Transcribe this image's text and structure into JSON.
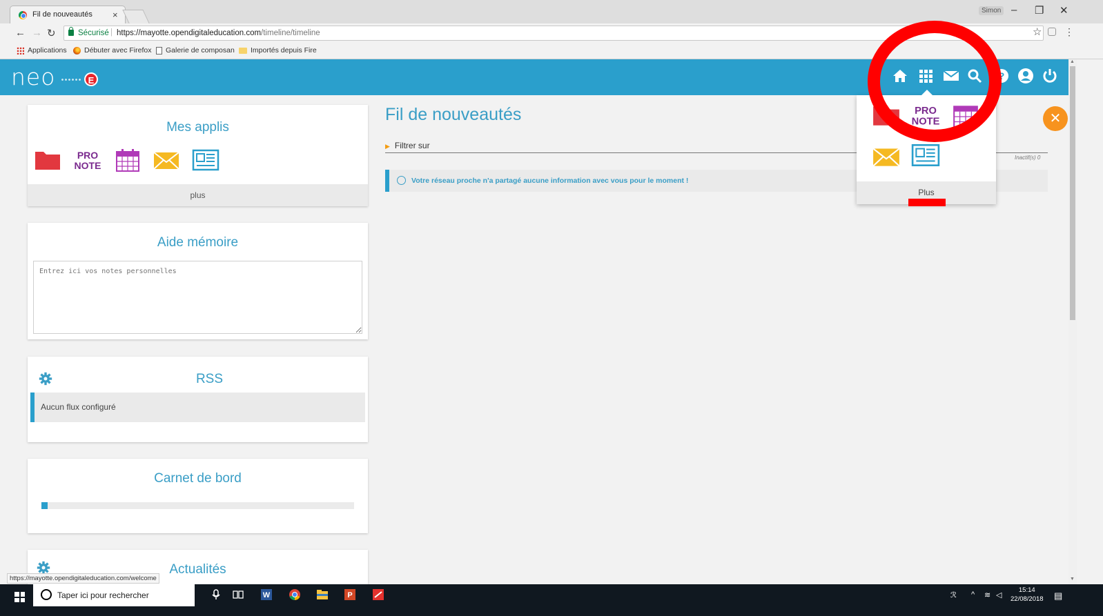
{
  "browser": {
    "tab_title": "Fil de nouveautés",
    "tab_close": "×",
    "user": "Simon",
    "win_minimize": "–",
    "win_restore": "❐",
    "win_close": "✕",
    "secure_label": "Sécurisé",
    "url_host": "https://mayotte.opendigitaleducation.com",
    "url_path": "/timeline/timeline",
    "bookmarks": [
      "Applications",
      "Débuter avec Firefox",
      "Galerie de composan",
      "Importés depuis Fire"
    ],
    "status_url": "https://mayotte.opendigitaleducation.com/welcome"
  },
  "header": {
    "logo": "neo",
    "logo_badge": "E",
    "icons": [
      "home-icon",
      "apps-grid-icon",
      "mail-icon",
      "search-icon",
      "help-icon",
      "user-icon",
      "power-icon"
    ],
    "color": "#2a9fcc"
  },
  "widgets": {
    "mes_applis": {
      "title": "Mes applis",
      "apps": [
        "folder-icon",
        "pronote-icon",
        "calendar-icon",
        "mail-icon",
        "news-icon"
      ],
      "pronote_line1": "PRO",
      "pronote_line2": "NOTE",
      "plus": "plus"
    },
    "aide_memoire": {
      "title": "Aide mémoire",
      "placeholder": "Entrez ici vos notes personnelles"
    },
    "rss": {
      "title": "RSS",
      "empty": "Aucun flux configuré"
    },
    "carnet": {
      "title": "Carnet de bord",
      "progress": 0.02
    },
    "actualites": {
      "title": "Actualités"
    }
  },
  "main": {
    "title": "Fil de nouveautés",
    "filter": "Filtrer sur",
    "inactifs": "Inactif(s) 0",
    "notice": "Votre réseau proche n'a partagé aucune information avec vous pour le moment !"
  },
  "dropdown": {
    "apps": [
      "folder-icon",
      "pronote-icon",
      "calendar-icon",
      "mail-icon",
      "news-icon"
    ],
    "pronote_line1": "PRO",
    "pronote_line2": "NOTE",
    "plus": "Plus"
  },
  "taskbar": {
    "search_placeholder": "Taper ici pour rechercher",
    "time": "15:14",
    "date": "22/08/2018",
    "notifications": "1"
  },
  "colors": {
    "accent": "#2a9fcc",
    "annotation": "#ff0000",
    "tools": "#f7931e"
  }
}
